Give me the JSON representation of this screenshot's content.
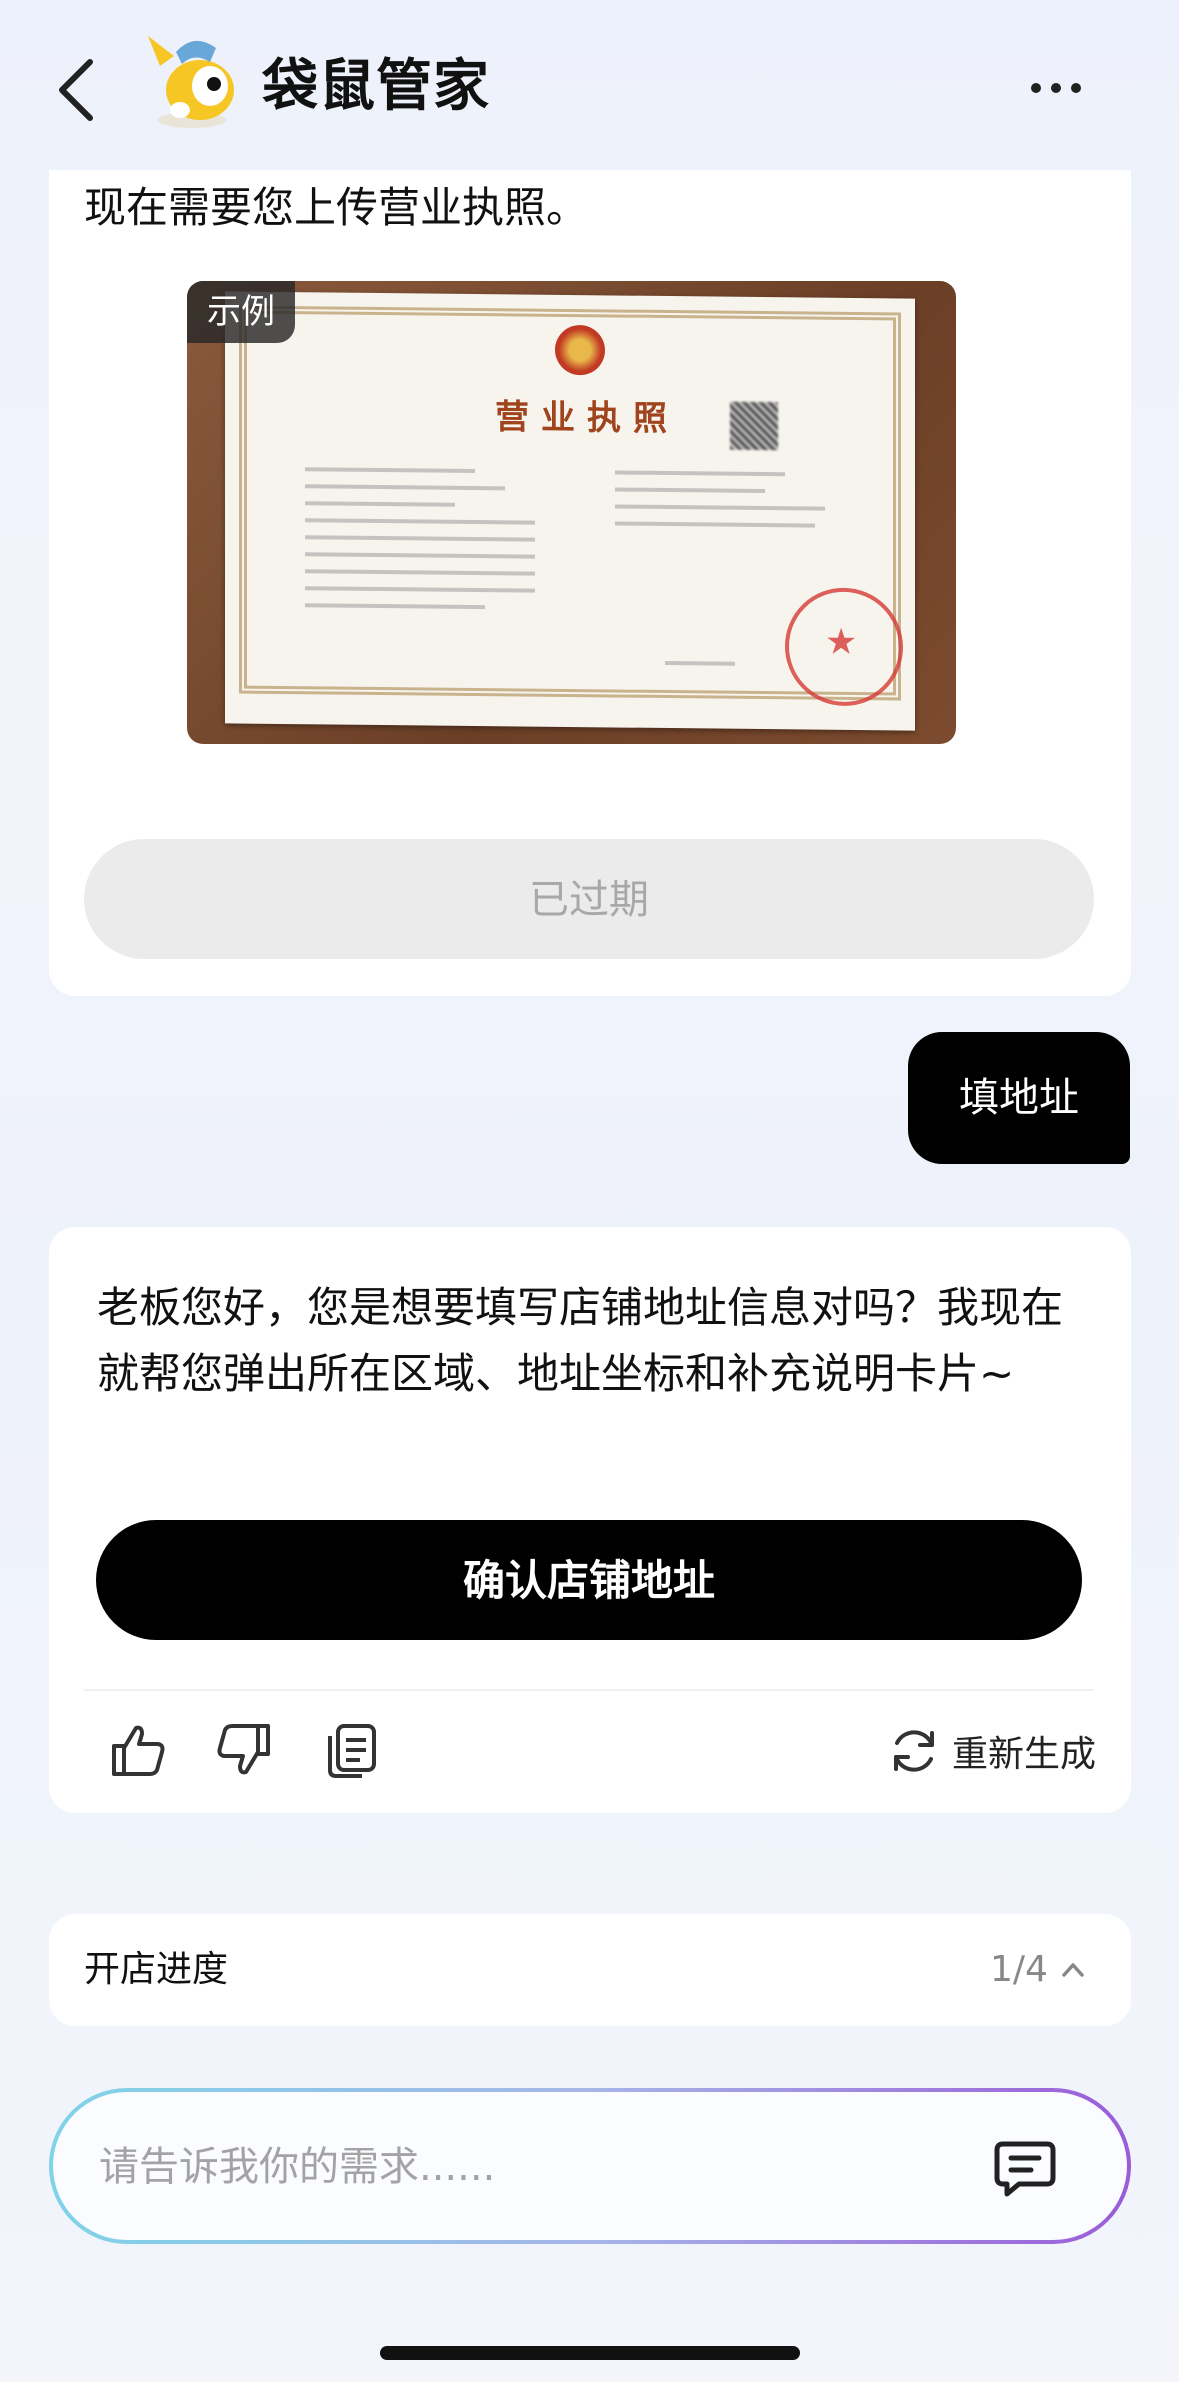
{
  "header": {
    "title": "袋鼠管家"
  },
  "messages": {
    "upload_prompt": "现在需要您上传营业执照。",
    "example_badge": "示例",
    "license_title": "营业执照",
    "expired_button": "已过期",
    "user_message": "填地址",
    "assistant_reply": "老板您好，您是想要填写店铺地址信息对吗？我现在就帮您弹出所在区域、地址坐标和补充说明卡片~",
    "confirm_button": "确认店铺地址",
    "regenerate_label": "重新生成"
  },
  "progress": {
    "label": "开店进度",
    "count": "1/4"
  },
  "input": {
    "placeholder": "请告诉我你的需求......"
  }
}
